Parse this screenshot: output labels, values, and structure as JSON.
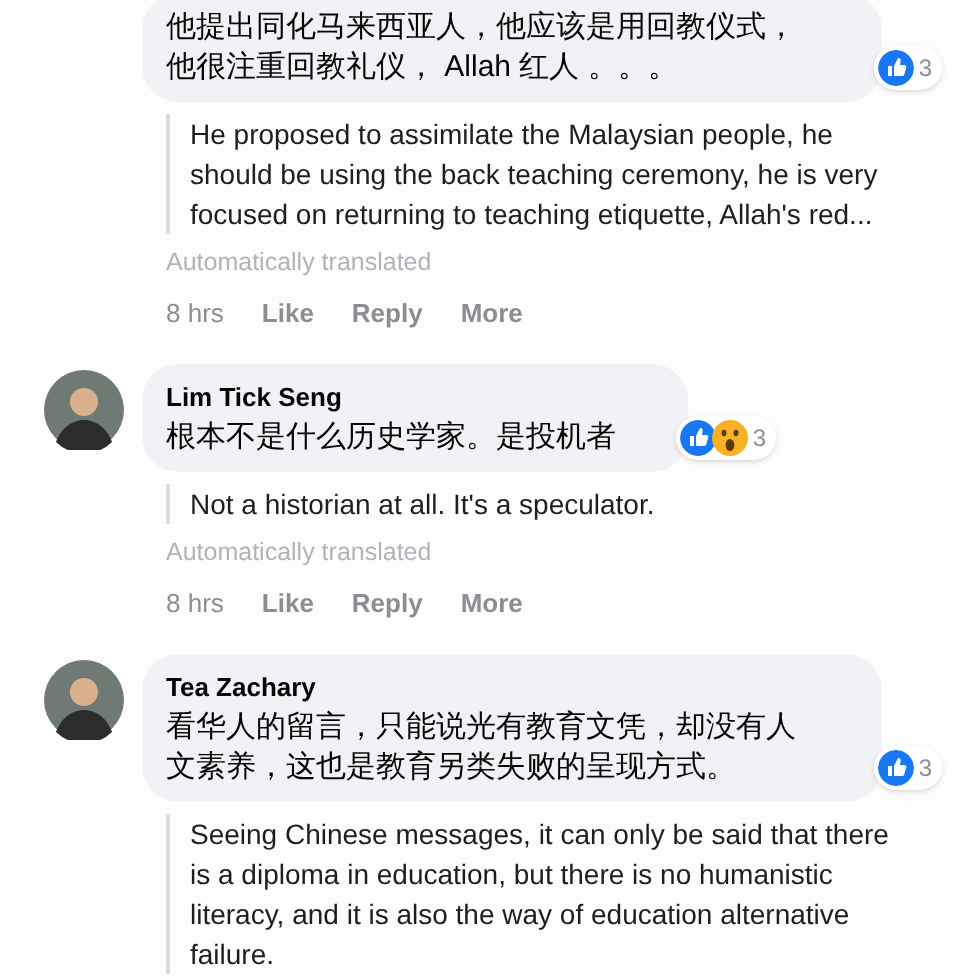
{
  "comments": [
    {
      "text_lines": [
        "他提出同化马来西亚人，他应该是用回教仪式，",
        "他很注重回教礼仪， Allah 红人 。。。"
      ],
      "reactions": [
        {
          "kind": "like"
        }
      ],
      "reaction_count": "3",
      "translation": "He proposed to assimilate the Malaysian people, he should be using the back teaching ceremony, he is very focused on returning to teaching etiquette, Allah's red...",
      "translated_note": "Automatically translated",
      "time": "8 hrs",
      "actions": [
        "Like",
        "Reply",
        "More"
      ]
    },
    {
      "author": "Lim Tick Seng",
      "text_lines": [
        "根本不是什么历史学家。是投机者"
      ],
      "reactions": [
        {
          "kind": "like"
        },
        {
          "kind": "wow"
        }
      ],
      "reaction_count": "3",
      "translation": "Not a historian at all. It's a speculator.",
      "translated_note": "Automatically translated",
      "time": "8 hrs",
      "actions": [
        "Like",
        "Reply",
        "More"
      ]
    },
    {
      "author": "Tea Zachary",
      "text_lines": [
        "看华人的留言，只能说光有教育文凭，却没有人",
        "文素养，这也是教育另类失败的呈现方式。"
      ],
      "reactions": [
        {
          "kind": "like"
        }
      ],
      "reaction_count": "3",
      "translation": "Seeing Chinese messages, it can only be said that there is a diploma in education, but there is no humanistic literacy, and it is also the way of education alternative failure."
    }
  ]
}
